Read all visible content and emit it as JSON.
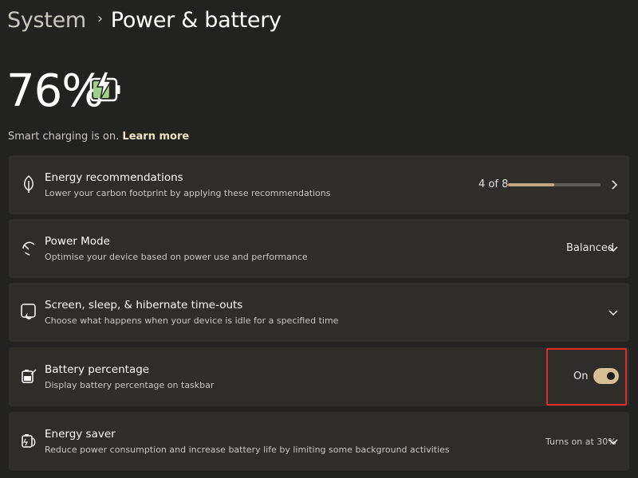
{
  "breadcrumb": {
    "parent": "System",
    "separator": "›",
    "current": "Power & battery"
  },
  "battery": {
    "percent": "76%",
    "level": 0.76
  },
  "smart_charging": {
    "text": "Smart charging is on.",
    "link": "Learn more"
  },
  "cards": {
    "energy_recommendations": {
      "title": "Energy recommendations",
      "description": "Lower your carbon footprint by applying these recommendations",
      "count": "4 of 8",
      "progress": 0.5
    },
    "power_mode": {
      "title": "Power Mode",
      "description": "Optimise your device based on power use and performance",
      "value": "Balanced"
    },
    "screen_sleep": {
      "title": "Screen, sleep, & hibernate time-outs",
      "description": "Choose what happens when your device is idle for a specified time"
    },
    "battery_percentage": {
      "title": "Battery percentage",
      "description": "Display battery percentage on taskbar",
      "toggle_label": "On",
      "toggle_on": true
    },
    "energy_saver": {
      "title": "Energy saver",
      "description": "Reduce power consumption and increase battery life by limiting some background activities",
      "value": "Turns on at 30%"
    }
  },
  "colors": {
    "background": "#222320",
    "card": "#2e2d2a",
    "accent": "#d6bf95",
    "battery_fill": "#9fd18a",
    "highlight": "#e02a2a"
  },
  "icons": [
    "leaf-icon",
    "speedometer-icon",
    "screen-sleep-icon",
    "battery-percentage-icon",
    "energy-saver-icon",
    "chevron-right-icon",
    "chevron-down-icon"
  ]
}
